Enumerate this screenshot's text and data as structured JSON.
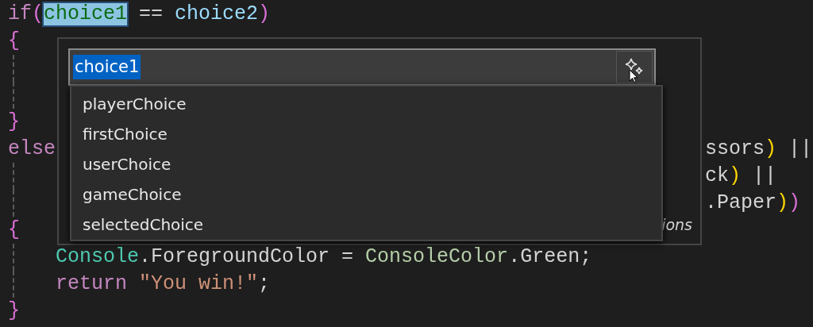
{
  "code_lines": [
    {
      "indented": false,
      "guide": false,
      "tokens": [
        {
          "text": "if",
          "kind": "keyword"
        },
        {
          "text": "(",
          "kind": "bracket1"
        },
        {
          "text": "choice1",
          "kind": "renamed"
        },
        {
          "text": "==",
          "kind": "operator"
        },
        {
          "text": "choice2",
          "kind": "variable"
        },
        {
          "text": ")",
          "kind": "bracket1"
        }
      ]
    },
    {
      "indented": false,
      "guide": false,
      "tokens": [
        {
          "text": "{",
          "kind": "bracket1"
        }
      ]
    },
    {
      "indented": false,
      "guide": true
    },
    {
      "indented": false,
      "guide": true
    },
    {
      "indented": false,
      "guide": false,
      "tokens": [
        {
          "text": "}",
          "kind": "bracket1"
        }
      ]
    },
    {
      "indented": false,
      "guide": false,
      "tokens": [
        {
          "text": "else",
          "kind": "keyword"
        }
      ],
      "right_tokens": [
        {
          "text": "ssors",
          "kind": "plain"
        },
        {
          "text": ")",
          "kind": "bracket2"
        },
        {
          "text": "||",
          "kind": "operator"
        }
      ]
    },
    {
      "indented": false,
      "guide": true,
      "right_tokens": [
        {
          "text": "ck",
          "kind": "plain"
        },
        {
          "text": ")",
          "kind": "bracket2"
        },
        {
          "text": "||",
          "kind": "operator"
        }
      ]
    },
    {
      "indented": false,
      "guide": true,
      "right_tokens": [
        {
          "text": ".Paper",
          "kind": "plain"
        },
        {
          "text": ")",
          "kind": "bracket2"
        },
        {
          "text": ")",
          "kind": "bracket1"
        }
      ]
    },
    {
      "indented": false,
      "guide": false,
      "tokens": [
        {
          "text": "{",
          "kind": "bracket1"
        }
      ]
    },
    {
      "indented": true,
      "guide": true,
      "tokens": [
        {
          "text": "Console",
          "kind": "type"
        },
        {
          "text": ".ForegroundColor",
          "kind": "plain"
        },
        {
          "text": "=",
          "kind": "operator"
        },
        {
          "text": "ConsoleColor",
          "kind": "enum"
        },
        {
          "text": ".Green;",
          "kind": "plain"
        }
      ]
    },
    {
      "indented": true,
      "guide": true,
      "tokens": [
        {
          "text": "return",
          "kind": "keyword"
        },
        {
          "text": "\"You win!\"",
          "kind": "string"
        },
        {
          "text": ";",
          "kind": "plain"
        }
      ]
    },
    {
      "indented": false,
      "guide": false,
      "tokens": [
        {
          "text": "}",
          "kind": "bracket1"
        }
      ]
    }
  ],
  "rename_widget": {
    "input": {
      "value": "choice1",
      "text_selected": true
    },
    "suggestions": [
      {
        "label": "playerChoice",
        "selected": false
      },
      {
        "label": "firstChoice",
        "selected": false
      },
      {
        "label": "userChoice",
        "selected": false
      },
      {
        "label": "gameChoice",
        "selected": false
      },
      {
        "label": "selectedChoice",
        "selected": false
      }
    ],
    "footer_fragment": "ions"
  }
}
